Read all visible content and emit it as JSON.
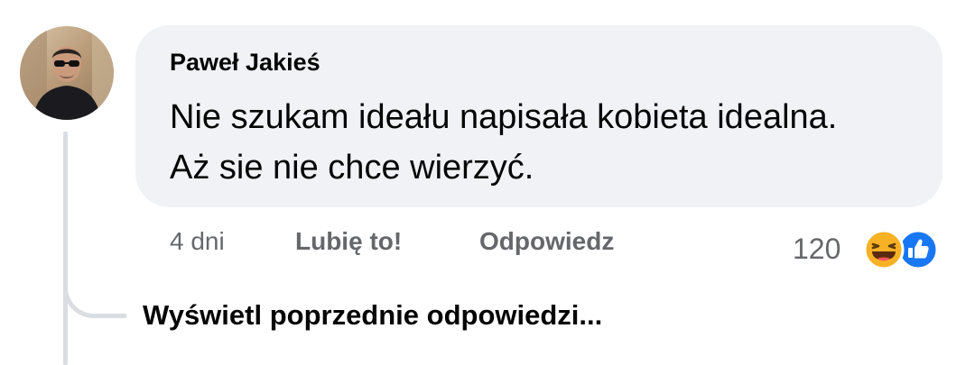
{
  "comment": {
    "author": "Paweł Jakieś",
    "text_line1": "Nie szukam ideału napisała kobieta idealna.",
    "text_line2": "Aż sie nie chce wierzyć.",
    "timestamp": "4 dni",
    "like_label": "Lubię to!",
    "reply_label": "Odpowiedz",
    "reaction_count": "120",
    "reactions": [
      "haha-icon",
      "like-icon"
    ]
  },
  "thread": {
    "view_previous_label": "Wyświetl poprzednie odpowiedzi..."
  },
  "colors": {
    "bubble": "#f0f2f5",
    "secondary_text": "#65676b",
    "primary_text": "#050505",
    "thread_line": "#dadde1",
    "like_blue": "#1877f2",
    "haha_yellow": "#f7b125"
  }
}
